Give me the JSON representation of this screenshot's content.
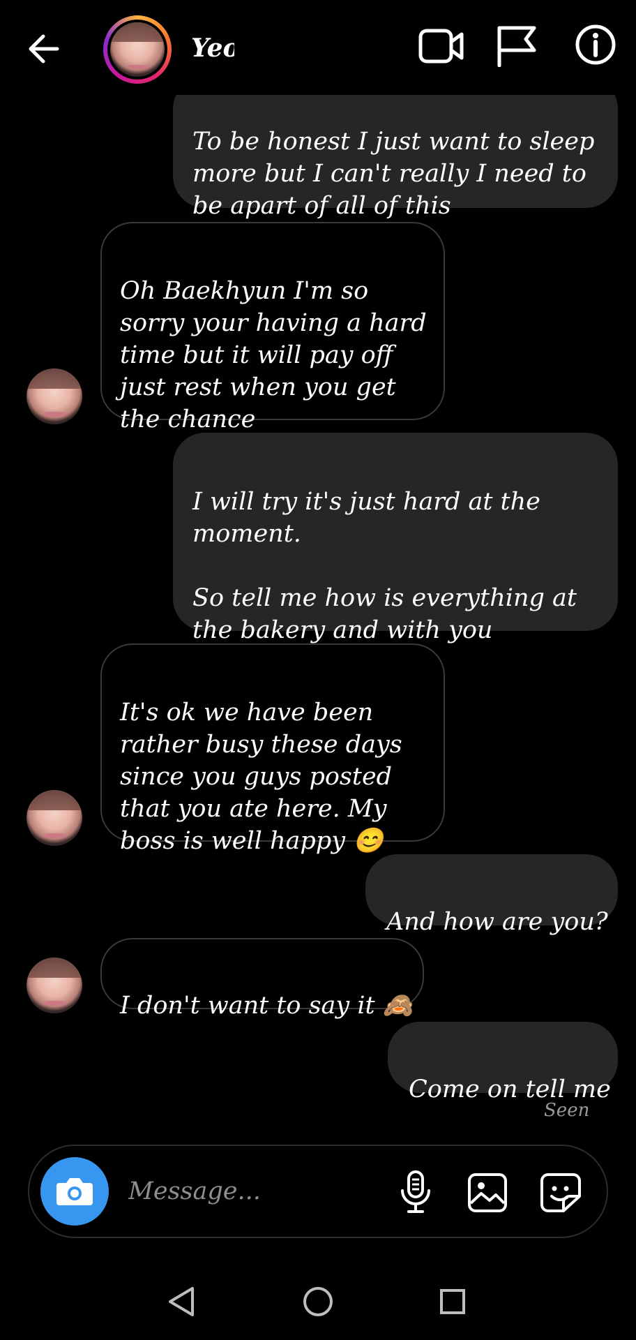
{
  "header": {
    "contact_name": "Yeol",
    "icons": {
      "back": "arrow-left-icon",
      "video_call": "video-camera-icon",
      "report": "flag-icon",
      "info": "info-circle-icon"
    },
    "story_ring_colors": [
      "#fdb441",
      "#f7762f",
      "#e3266b",
      "#c8189c",
      "#8a2cd1"
    ]
  },
  "messages": [
    {
      "from": "me",
      "text": "To be honest I just want to sleep more but I can't really I need to be apart of all of this"
    },
    {
      "from": "them",
      "text": "Oh Baekhyun I'm so sorry your having a hard time but it will pay off just rest when you get the chance"
    },
    {
      "from": "me",
      "text": "I will try it's just hard at the moment.\n\nSo tell me how is everything at the bakery and with you"
    },
    {
      "from": "them",
      "text": "It's ok we have been rather busy these days since you guys posted that you ate here. My boss is well happy 😊"
    },
    {
      "from": "me",
      "text": "And how are you?"
    },
    {
      "from": "them",
      "text": "I don't want to say it 🙈"
    },
    {
      "from": "me",
      "text": "Come on tell me"
    }
  ],
  "status": {
    "seen": "Seen"
  },
  "composer": {
    "placeholder": "Message...",
    "icons": [
      "camera-icon",
      "microphone-icon",
      "gallery-icon",
      "sticker-icon"
    ],
    "camera_button_color": "#3797f0"
  },
  "navbar": {
    "icons": [
      "back-triangle-icon",
      "home-circle-icon",
      "recents-square-icon"
    ]
  },
  "colors": {
    "sent_bubble": "#262626",
    "background": "#000000",
    "received_border": "#3a3a3a"
  }
}
